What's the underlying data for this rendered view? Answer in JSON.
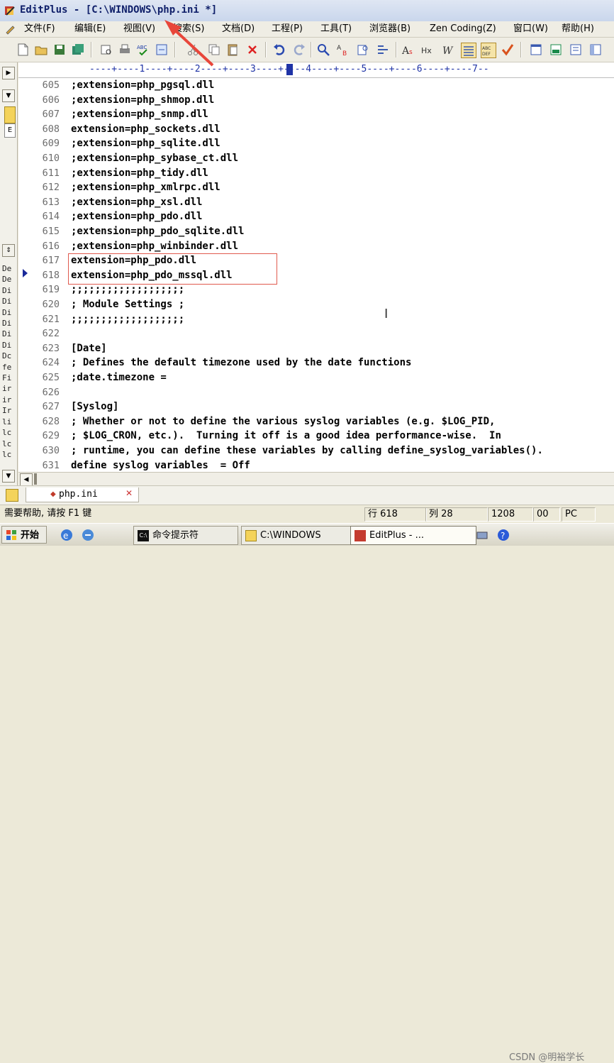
{
  "titlebar": {
    "title": "EditPlus - [C:\\WINDOWS\\php.ini *]"
  },
  "menu": [
    "文件(F)",
    "编辑(E)",
    "视图(V)",
    "搜索(S)",
    "文档(D)",
    "工程(P)",
    "工具(T)",
    "浏览器(B)",
    "Zen Coding(Z)",
    "窗口(W)",
    "帮助(H)"
  ],
  "ruler": {
    "text": "----+----1----+----2----+----3----+----4----+----5----+----6----+----7--"
  },
  "lines": [
    {
      "num": "605",
      "text": ";extension=php_pgsql.dll"
    },
    {
      "num": "606",
      "text": ";extension=php_shmop.dll"
    },
    {
      "num": "607",
      "text": ";extension=php_snmp.dll"
    },
    {
      "num": "608",
      "text": "extension=php_sockets.dll"
    },
    {
      "num": "609",
      "text": ";extension=php_sqlite.dll"
    },
    {
      "num": "610",
      "text": ";extension=php_sybase_ct.dll"
    },
    {
      "num": "611",
      "text": ";extension=php_tidy.dll"
    },
    {
      "num": "612",
      "text": ";extension=php_xmlrpc.dll"
    },
    {
      "num": "613",
      "text": ";extension=php_xsl.dll"
    },
    {
      "num": "614",
      "text": ";extension=php_pdo.dll"
    },
    {
      "num": "615",
      "text": ";extension=php_pdo_sqlite.dll"
    },
    {
      "num": "616",
      "text": ";extension=php_winbinder.dll"
    },
    {
      "num": "617",
      "text": "extension=php_pdo.dll"
    },
    {
      "num": "618",
      "text": "extension=php_pdo_mssql.dll"
    },
    {
      "num": "619",
      "text": ";;;;;;;;;;;;;;;;;;;"
    },
    {
      "num": "620",
      "text": "; Module Settings ;"
    },
    {
      "num": "621",
      "text": ";;;;;;;;;;;;;;;;;;;"
    },
    {
      "num": "622",
      "text": ""
    },
    {
      "num": "623",
      "text": "[Date]"
    },
    {
      "num": "624",
      "text": "; Defines the default timezone used by the date functions"
    },
    {
      "num": "625",
      "text": ";date.timezone ="
    },
    {
      "num": "626",
      "text": ""
    },
    {
      "num": "627",
      "text": "[Syslog]"
    },
    {
      "num": "628",
      "text": "; Whether or not to define the various syslog variables (e.g. $LOG_PID,"
    },
    {
      "num": "629",
      "text": "; $LOG_CRON, etc.).  Turning it off is a good idea performance-wise.  In"
    },
    {
      "num": "630",
      "text": "; runtime, you can define these variables by calling define_syslog_variables()."
    },
    {
      "num": "631",
      "text": "define syslog variables  = Off"
    }
  ],
  "left_pane": {
    "list": [
      "De",
      "De",
      "Di",
      "Di",
      "Di",
      "Di",
      "Di",
      "Di",
      "Dc",
      "fe",
      "Fi",
      "ir",
      "ir",
      "Ir",
      "li",
      "lc",
      "lc",
      "lc"
    ]
  },
  "file_tab": {
    "label": "php.ini"
  },
  "status": {
    "help": "需要帮助, 请按 F1 键",
    "row": "行 618",
    "col": "列 28",
    "size": "1208",
    "mode": "00",
    "fmt": "PC"
  },
  "taskbar": {
    "start": "开始",
    "tasks": [
      "命令提示符",
      "C:\\WINDOWS",
      "EditPlus - ..."
    ],
    "watermark": "CSDN @明裕学长"
  },
  "colors": {
    "line_numbers": "#6c6c6c",
    "ruler": "#1f33a6",
    "highlight_box": "#e05a4e",
    "annotation_arrow": "#e8463a"
  }
}
